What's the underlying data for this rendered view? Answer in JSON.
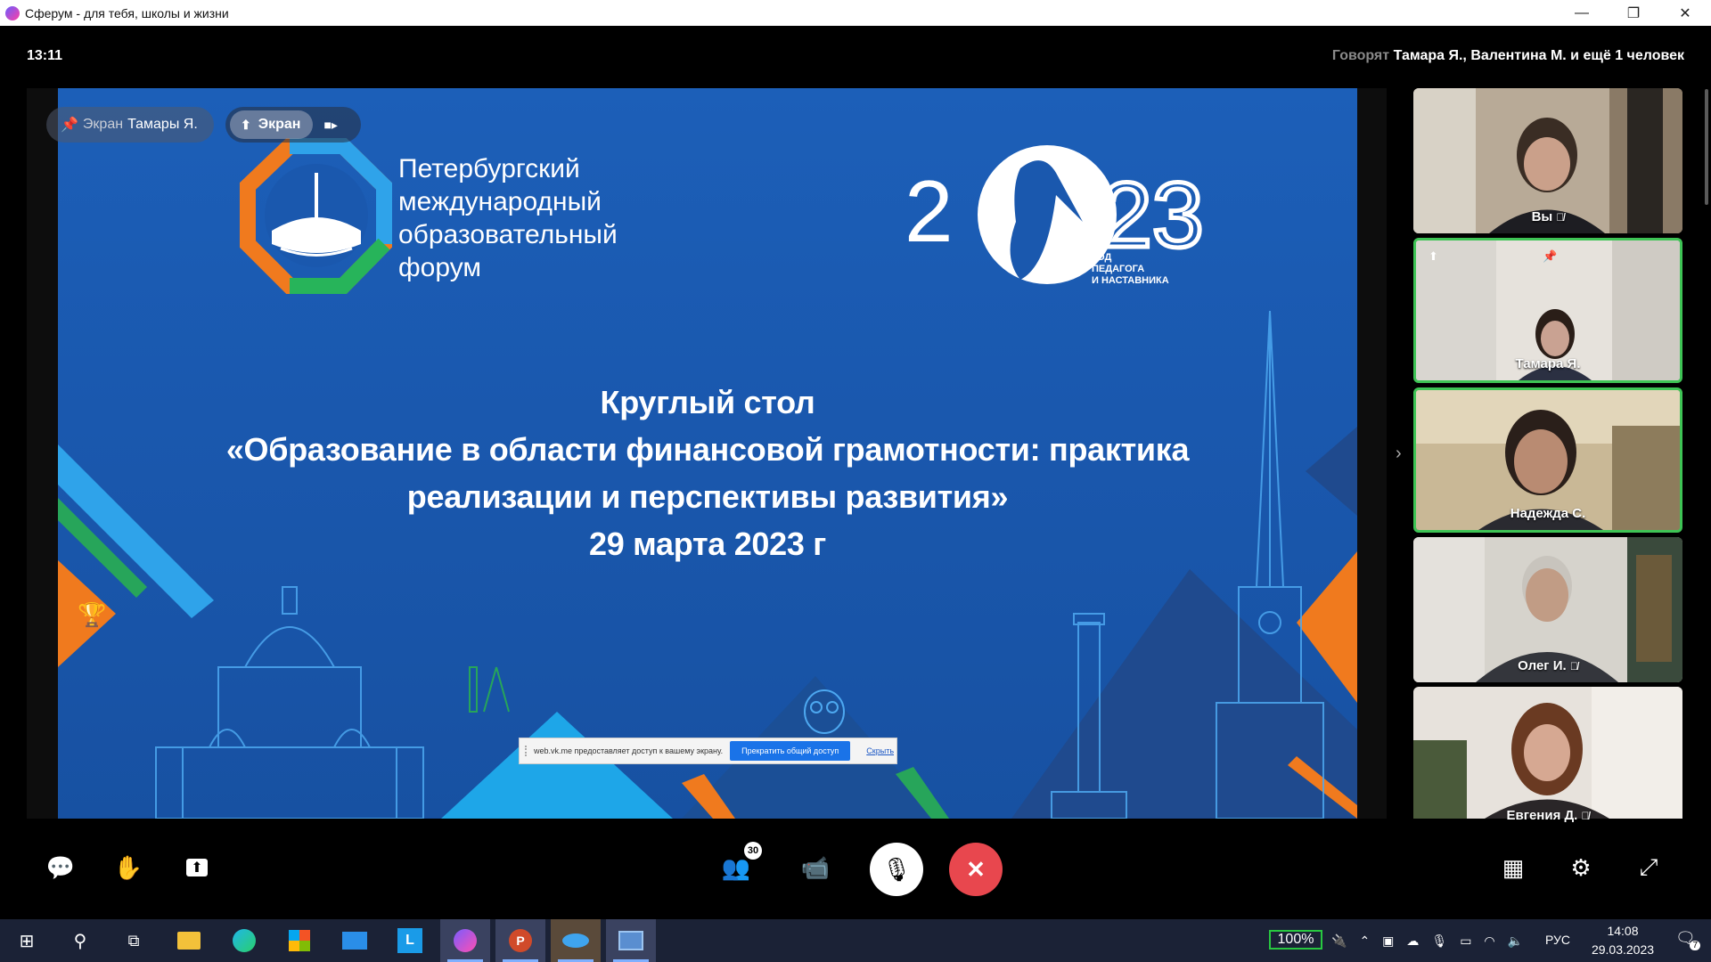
{
  "window": {
    "title": "Сферум - для тебя, школы и жизни",
    "controls": [
      "—",
      "❐",
      "✕"
    ]
  },
  "topbar": {
    "time": "13:11",
    "speaking_label": "Говорят",
    "speaking_names": "Тамара Я., Валентина М. и ещё 1 человек"
  },
  "pills": {
    "pinned_prefix": "Экран",
    "pinned_name": "Тамары Я.",
    "screen_label": "Экран"
  },
  "slide": {
    "forum_lines": [
      "Петербургский",
      "международный",
      "образовательный",
      "форум"
    ],
    "year_sub": [
      "ГОД",
      "ПЕДАГОГА",
      "И НАСТАВНИКА"
    ],
    "heading_lines": [
      "Круглый стол",
      "«Образование в области финансовой грамотности: практика",
      "реализации и перспективы развития»",
      "29 марта 2023 г"
    ],
    "year_text": "2023"
  },
  "sharebar": {
    "text": "web.vk.me предоставляет доступ к вашему экрану.",
    "stop": "Прекратить общий доступ",
    "hide": "Скрыть"
  },
  "participants": [
    {
      "name": "Вы",
      "muted": true,
      "active": false
    },
    {
      "name": "Тамара Я.",
      "muted": false,
      "active": true
    },
    {
      "name": "Надежда С.",
      "muted": false,
      "active": true
    },
    {
      "name": "Олег И.",
      "muted": true,
      "active": false
    },
    {
      "name": "Евгения Д.",
      "muted": true,
      "active": false
    }
  ],
  "controls": {
    "participants_count": "30"
  },
  "taskbar": {
    "battery": "100%",
    "lang": "РУС",
    "time": "14:08",
    "date": "29.03.2023",
    "notifications": "7"
  },
  "colors": {
    "accent_green": "#3ec455",
    "end_call": "#e8474e",
    "slide_blue": "#1a58ae"
  }
}
